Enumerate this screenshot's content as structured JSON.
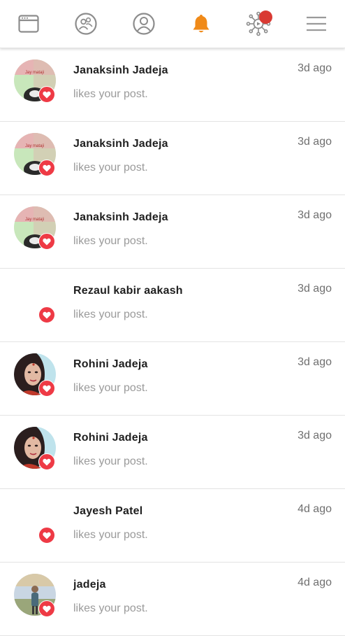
{
  "nav": {
    "items": [
      {
        "icon": "browser-window-icon",
        "active": false
      },
      {
        "icon": "friends-icon",
        "active": false
      },
      {
        "icon": "profile-icon",
        "active": false
      },
      {
        "icon": "bell-icon",
        "active": true
      },
      {
        "icon": "network-icon",
        "active": false,
        "badge": true
      },
      {
        "icon": "menu-icon",
        "active": false
      }
    ],
    "colors": {
      "inactive": "#8c8c8c",
      "active": "#f08a18",
      "badge": "#d93a33"
    }
  },
  "notifications": [
    {
      "name": "Janaksinh Jadeja",
      "message": "likes your post.",
      "time": "3d ago",
      "avatar": "janaksinh"
    },
    {
      "name": "Janaksinh Jadeja",
      "message": "likes your post.",
      "time": "3d ago",
      "avatar": "janaksinh"
    },
    {
      "name": "Janaksinh Jadeja",
      "message": "likes your post.",
      "time": "3d ago",
      "avatar": "janaksinh"
    },
    {
      "name": "Rezaul kabir aakash",
      "message": "likes your post.",
      "time": "3d ago",
      "avatar": "none"
    },
    {
      "name": "Rohini Jadeja",
      "message": "likes your post.",
      "time": "3d ago",
      "avatar": "rohini"
    },
    {
      "name": "Rohini Jadeja",
      "message": "likes your post.",
      "time": "3d ago",
      "avatar": "rohini"
    },
    {
      "name": "Jayesh Patel",
      "message": "likes your post.",
      "time": "4d ago",
      "avatar": "none"
    },
    {
      "name": "jadeja",
      "message": "likes your post.",
      "time": "4d ago",
      "avatar": "jadeja"
    }
  ],
  "reaction": {
    "icon": "heart-icon",
    "color": "#ee3a45"
  }
}
